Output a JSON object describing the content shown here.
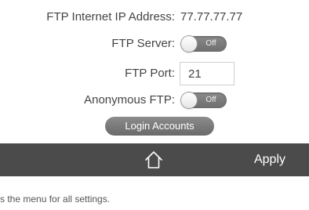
{
  "form": {
    "ip_label": "FTP Internet IP Address:",
    "ip_value": "77.77.77.77",
    "server_label": "FTP Server:",
    "server_toggle": "Off",
    "port_label": "FTP Port:",
    "port_value": "21",
    "anon_label": "Anonymous FTP:",
    "anon_toggle": "Off",
    "login_button": "Login Accounts"
  },
  "bottom_bar": {
    "home_icon": "home-icon",
    "apply_label": "Apply"
  },
  "caption": "s the menu for all settings.",
  "colors": {
    "accent": "#6fb43f",
    "bar": "#4b4b4b",
    "toggle": "#7a7a7a"
  }
}
